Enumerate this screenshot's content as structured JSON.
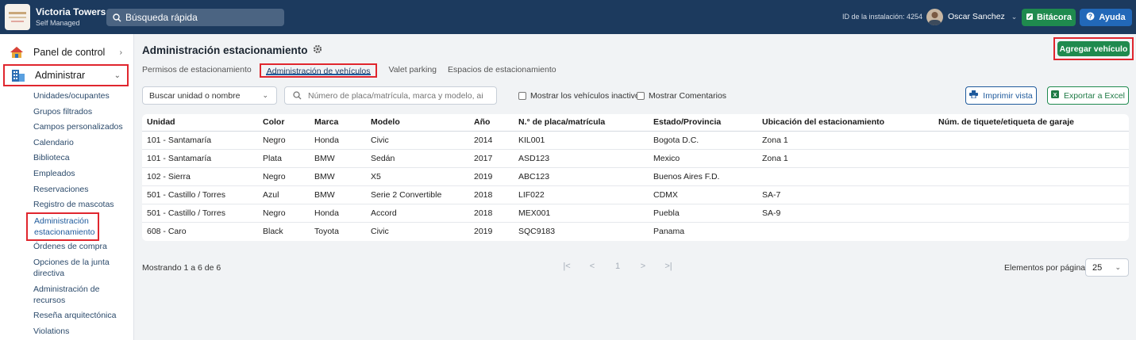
{
  "topbar": {
    "app_name": "Victoria Towers",
    "app_sub": "Self Managed",
    "search_placeholder": "Búsqueda rápida",
    "install_id": "ID de la instalación: 4254",
    "user_name": "Oscar Sanchez",
    "bitacora_label": "Bitácora",
    "ayuda_label": "Ayuda"
  },
  "sidebar": {
    "panel_label": "Panel de control",
    "admin_label": "Administrar",
    "links": [
      "Unidades/ocupantes",
      "Grupos filtrados",
      "Campos personalizados",
      "Calendario",
      "Biblioteca",
      "Empleados",
      "Reservaciones",
      "Registro de mascotas"
    ],
    "active_link_line1": "Administración",
    "active_link_line2": "estacionamiento",
    "links_after": [
      "Órdenes de compra",
      "Opciones de la junta",
      "directiva",
      "Administración de",
      "recursos",
      "Reseña arquitectónica",
      "Violations"
    ]
  },
  "page": {
    "title": "Administración estacionamiento",
    "add_button": "Agregar vehículo",
    "tabs": [
      "Permisos de estacionamiento",
      "Administración de vehículos",
      "Valet parking",
      "Espacios de estacionamiento"
    ],
    "active_tab_index": 1
  },
  "filters": {
    "unit_select": "Buscar unidad o nombre",
    "search_placeholder": "Número de placa/matrícula, marca y modelo, año",
    "inactive_label": "Mostrar los vehículos inactivos",
    "comments_label": "Mostrar Comentarios",
    "print_label": "Imprimir vista",
    "excel_label": "Exportar a Excel"
  },
  "table": {
    "headers": [
      "Unidad",
      "Color",
      "Marca",
      "Modelo",
      "Año",
      "N.° de placa/matrícula",
      "Estado/Provincia",
      "Ubicación del estacionamiento",
      "Núm. de tiquete/etiqueta de garaje"
    ],
    "rows": [
      [
        "101 - Santamaría",
        "Negro",
        "Honda",
        "Civic",
        "2014",
        "KIL001",
        "Bogota D.C.",
        "Zona 1",
        ""
      ],
      [
        "101 - Santamaría",
        "Plata",
        "BMW",
        "Sedán",
        "2017",
        "ASD123",
        "Mexico",
        "Zona 1",
        ""
      ],
      [
        "102 - Sierra",
        "Negro",
        "BMW",
        "X5",
        "2019",
        "ABC123",
        "Buenos Aires F.D.",
        "",
        ""
      ],
      [
        "501 - Castillo / Torres",
        "Azul",
        "BMW",
        "Serie 2 Convertible",
        "2018",
        "LIF022",
        "CDMX",
        "SA-7",
        ""
      ],
      [
        "501 - Castillo / Torres",
        "Negro",
        "Honda",
        "Accord",
        "2018",
        "MEX001",
        "Puebla",
        "SA-9",
        ""
      ],
      [
        "608 - Caro",
        "Black",
        "Toyota",
        "Civic",
        "2019",
        "SQC9183",
        "Panama",
        "",
        ""
      ]
    ]
  },
  "footer": {
    "count_text": "Mostrando 1 a 6 de 6",
    "page_first": "|<",
    "page_prev": "<",
    "page_current": "1",
    "page_next": ">",
    "page_last": ">|",
    "per_page_label": "Elementos por página",
    "per_page_value": "25"
  },
  "colors": {
    "topbar": "#1c3a5e",
    "green": "#1f8a4e",
    "blue": "#2268b8",
    "highlight": "#e0262e"
  }
}
